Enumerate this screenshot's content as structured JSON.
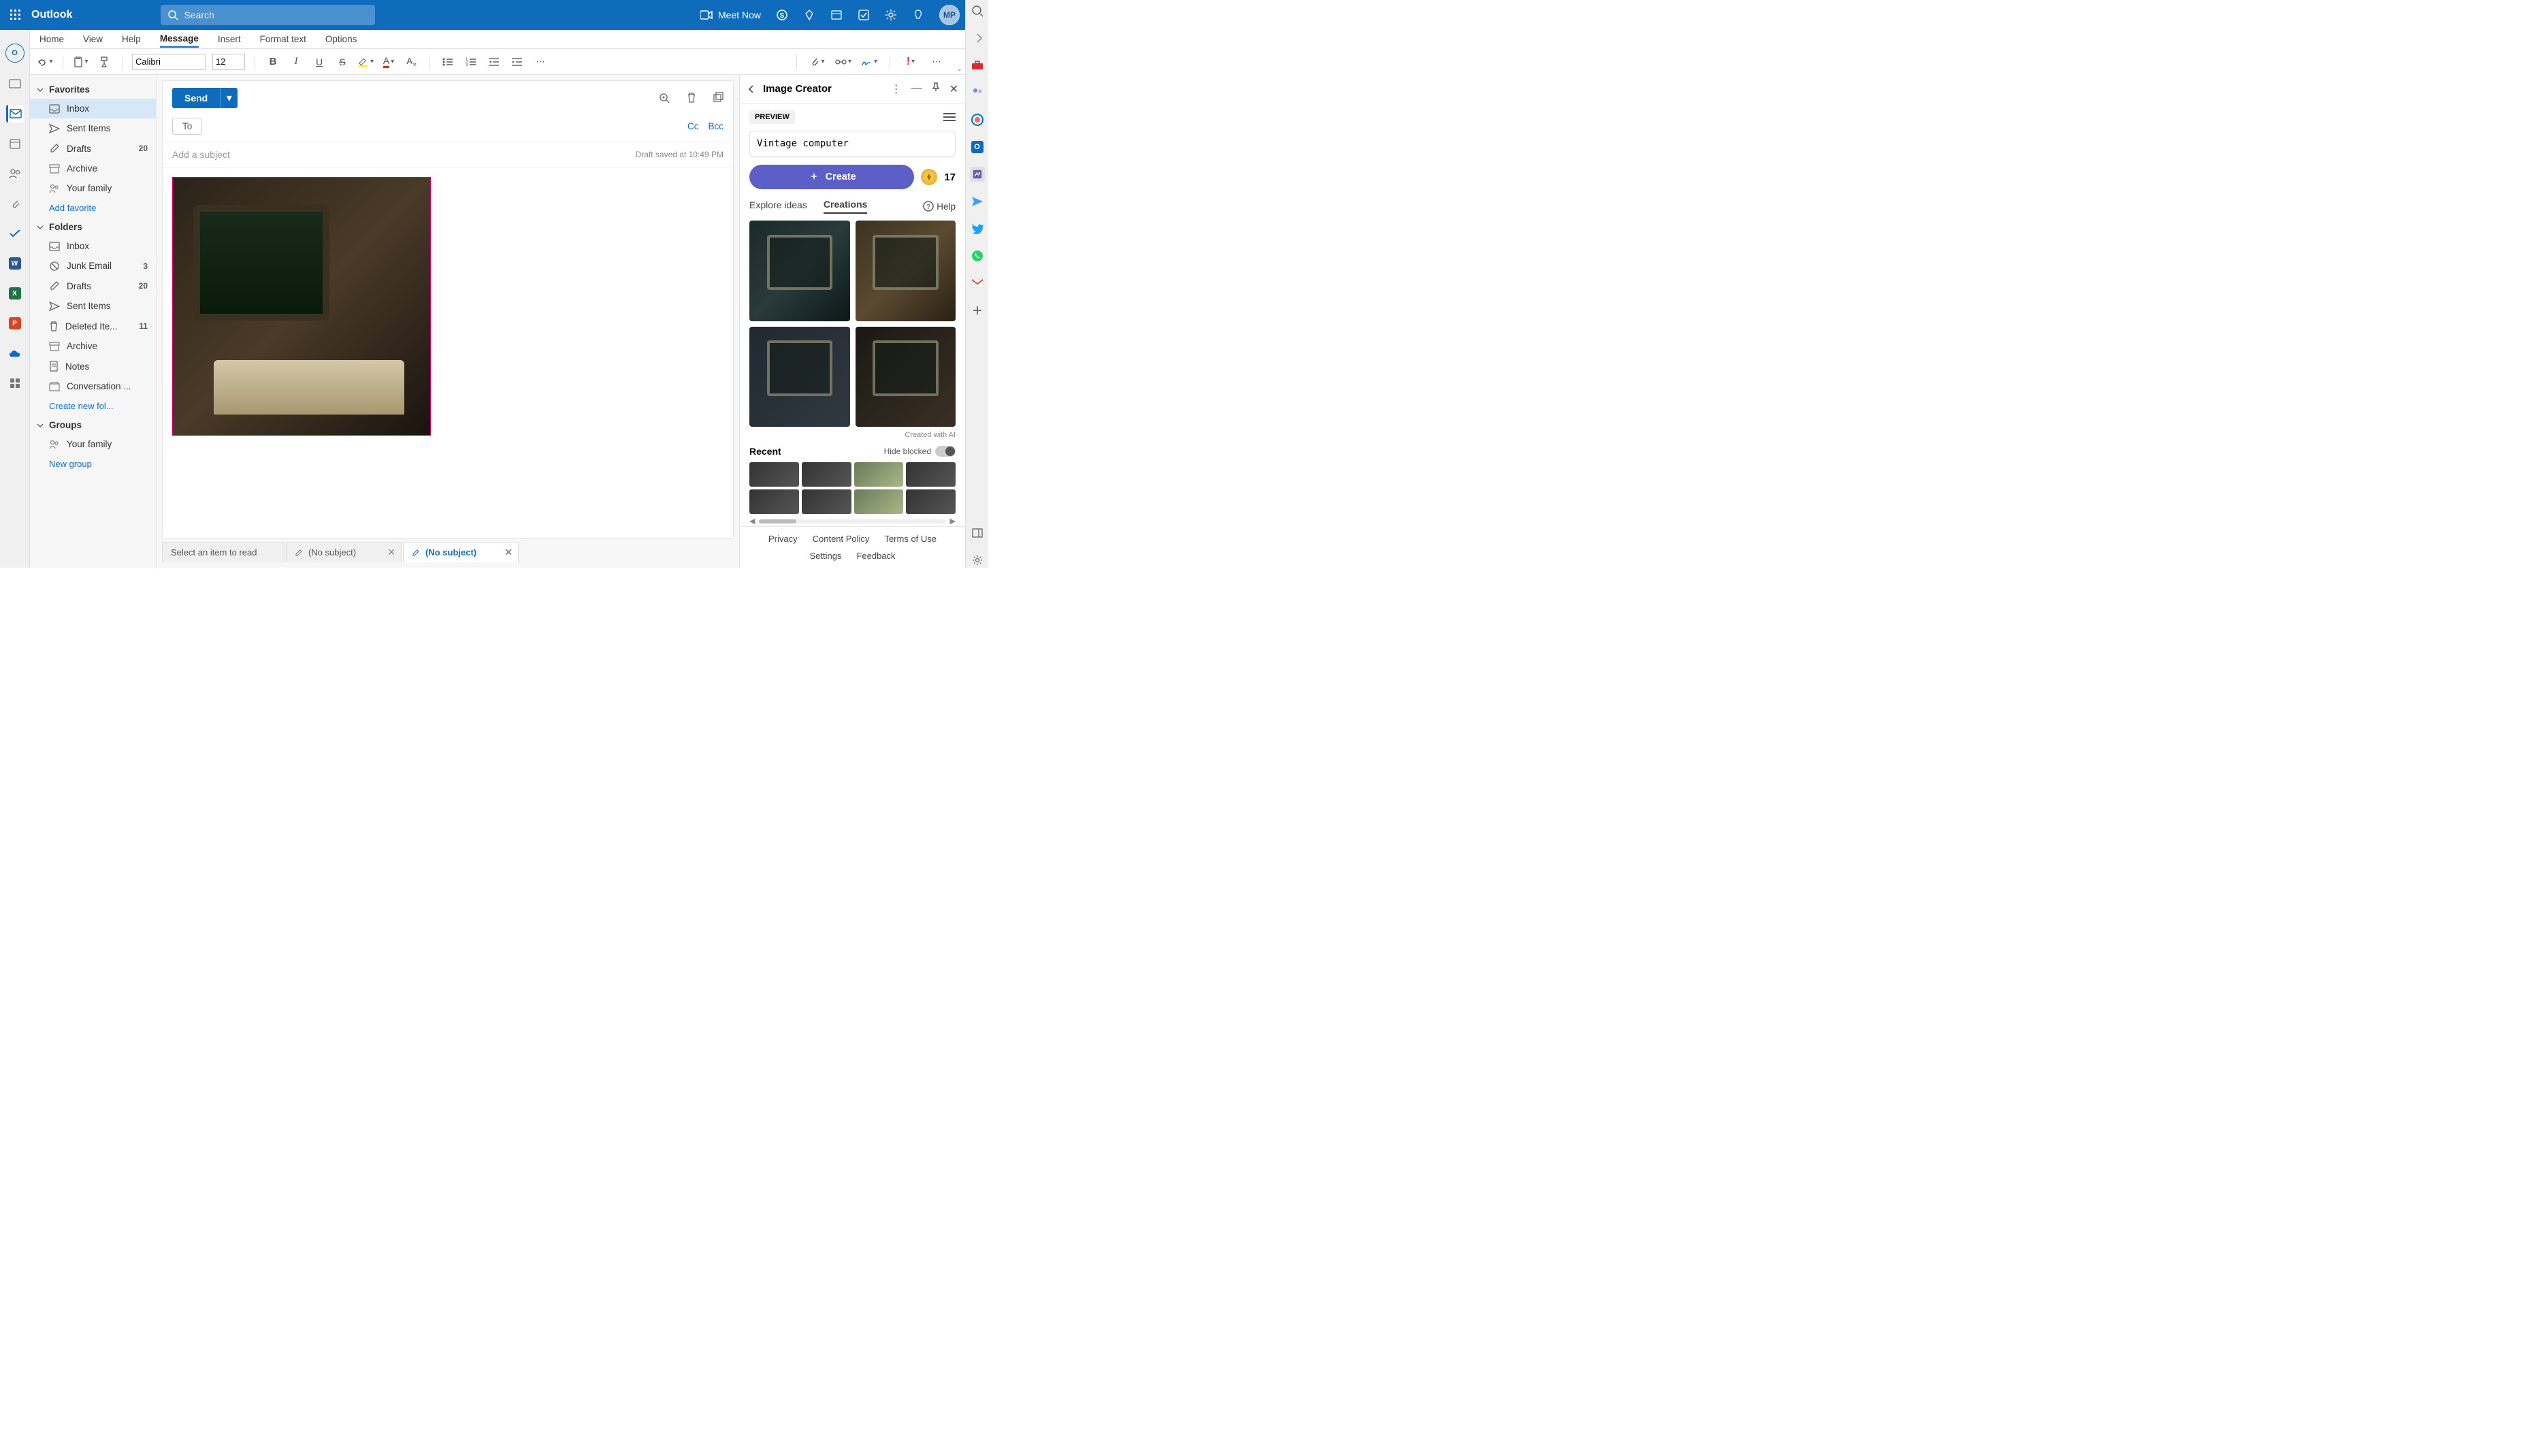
{
  "titlebar": {
    "app_name": "Outlook",
    "search_placeholder": "Search",
    "meet_now": "Meet Now",
    "avatar_initials": "MP"
  },
  "ribbon_tabs": [
    "Home",
    "View",
    "Help",
    "Message",
    "Insert",
    "Format text",
    "Options"
  ],
  "ribbon_active_index": 3,
  "toolbar": {
    "font_name": "Calibri",
    "font_size": "12"
  },
  "folders": {
    "favorites_label": "Favorites",
    "favorites": [
      {
        "name": "Inbox",
        "icon": "inbox"
      },
      {
        "name": "Sent Items",
        "icon": "send"
      },
      {
        "name": "Drafts",
        "count": "20",
        "icon": "draft"
      },
      {
        "name": "Archive",
        "icon": "archive"
      },
      {
        "name": "Your family",
        "icon": "people"
      }
    ],
    "add_favorite": "Add favorite",
    "folders_label": "Folders",
    "folders_items": [
      {
        "name": "Inbox",
        "icon": "inbox"
      },
      {
        "name": "Junk Email",
        "count": "3",
        "icon": "junk"
      },
      {
        "name": "Drafts",
        "count": "20",
        "icon": "draft"
      },
      {
        "name": "Sent Items",
        "icon": "send"
      },
      {
        "name": "Deleted Ite...",
        "count": "11",
        "icon": "trash"
      },
      {
        "name": "Archive",
        "icon": "archive"
      },
      {
        "name": "Notes",
        "icon": "note"
      },
      {
        "name": "Conversation ...",
        "icon": "conv"
      }
    ],
    "create_folder": "Create new fol...",
    "groups_label": "Groups",
    "groups_items": [
      {
        "name": "Your family",
        "icon": "people"
      }
    ],
    "new_group": "New group"
  },
  "compose": {
    "send_label": "Send",
    "to_label": "To",
    "cc_label": "Cc",
    "bcc_label": "Bcc",
    "subject_placeholder": "Add a subject",
    "saved_text": "Draft saved at 10:49 PM"
  },
  "bottom_tabs": {
    "reading_label": "Select an item to read",
    "draft1": "(No subject)",
    "draft2": "(No subject)"
  },
  "creator": {
    "title": "Image Creator",
    "preview_label": "PREVIEW",
    "prompt_text": "Vintage computer",
    "create_label": "Create",
    "credits": "17",
    "tab_explore": "Explore ideas",
    "tab_creations": "Creations",
    "help_label": "Help",
    "created_note": "Created with AI",
    "recent_label": "Recent",
    "hide_blocked": "Hide blocked",
    "footer": {
      "privacy": "Privacy",
      "content_policy": "Content Policy",
      "terms": "Terms of Use",
      "settings": "Settings",
      "feedback": "Feedback"
    }
  }
}
